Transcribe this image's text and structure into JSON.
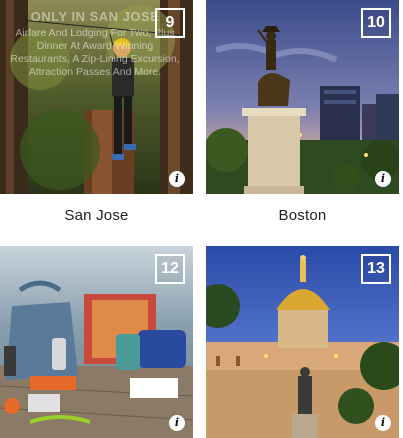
{
  "cards": [
    {
      "number": "9",
      "caption": "San Jose",
      "overlay_logo": "ONLY IN SAN JOSE",
      "overlay_text": "Airfare And Lodging For Two, Plus Dinner At Award-Winning Restaurants, A Zip-Lining Excursion, Attraction Passes And More.",
      "info_icon": "i"
    },
    {
      "number": "10",
      "caption": "Boston",
      "info_icon": "i"
    },
    {
      "number": "12",
      "caption": "",
      "info_icon": "i"
    },
    {
      "number": "13",
      "caption": "",
      "info_icon": "i"
    }
  ]
}
